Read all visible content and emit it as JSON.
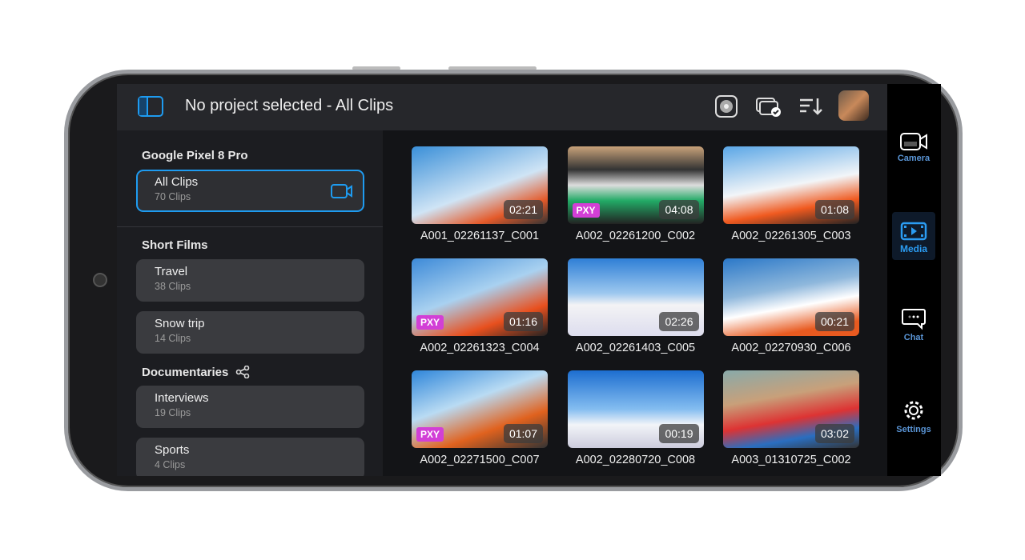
{
  "header": {
    "title": "No project selected - All Clips",
    "icons": [
      "sidebar-toggle-icon",
      "aperture-icon",
      "clip-select-icon",
      "sort-icon",
      "avatar"
    ]
  },
  "sidebar": {
    "device": "Google Pixel 8 Pro",
    "all_clips": {
      "name": "All Clips",
      "count": "70 Clips"
    },
    "projects": [
      {
        "title": "Short Films",
        "shared": false,
        "items": [
          {
            "name": "Travel",
            "count": "38 Clips"
          },
          {
            "name": "Snow trip",
            "count": "14 Clips"
          }
        ]
      },
      {
        "title": "Documentaries",
        "shared": true,
        "items": [
          {
            "name": "Interviews",
            "count": "19 Clips"
          },
          {
            "name": "Sports",
            "count": "4 Clips"
          }
        ]
      }
    ]
  },
  "clips": [
    {
      "name": "A001_02261137_C001",
      "duration": "02:21",
      "proxy": false
    },
    {
      "name": "A002_02261200_C002",
      "duration": "04:08",
      "proxy": true
    },
    {
      "name": "A002_02261305_C003",
      "duration": "01:08",
      "proxy": false
    },
    {
      "name": "A002_02261323_C004",
      "duration": "01:16",
      "proxy": true
    },
    {
      "name": "A002_02261403_C005",
      "duration": "02:26",
      "proxy": false
    },
    {
      "name": "A002_02270930_C006",
      "duration": "00:21",
      "proxy": false
    },
    {
      "name": "A002_02271500_C007",
      "duration": "01:07",
      "proxy": true
    },
    {
      "name": "A002_02280720_C008",
      "duration": "00:19",
      "proxy": false
    },
    {
      "name": "A003_01310725_C002",
      "duration": "03:02",
      "proxy": false
    }
  ],
  "proxy_label": "PXY",
  "rail": [
    {
      "label": "Camera",
      "active": false
    },
    {
      "label": "Media",
      "active": true
    },
    {
      "label": "Chat",
      "active": false
    },
    {
      "label": "Settings",
      "active": false
    }
  ],
  "colors": {
    "accent": "#1e9bf0",
    "proxy": "#d23fd6"
  }
}
